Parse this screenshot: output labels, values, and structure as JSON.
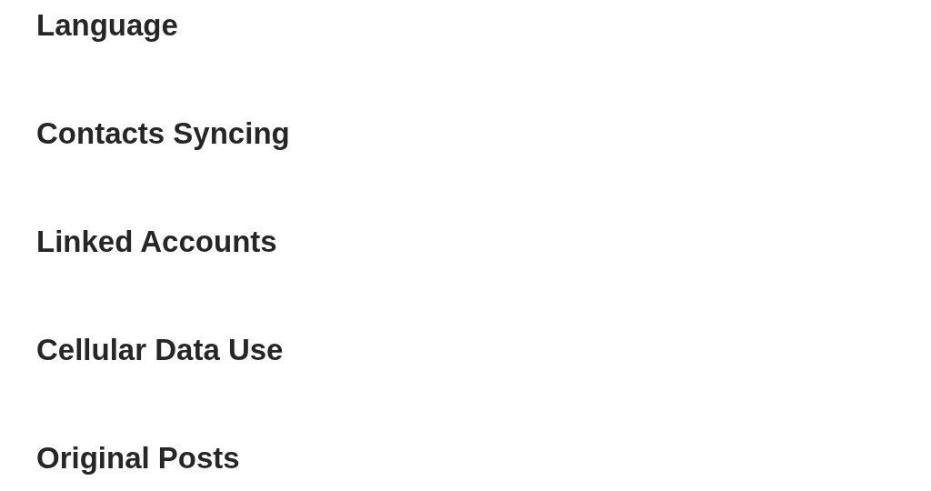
{
  "settings_items": [
    {
      "label": "Language"
    },
    {
      "label": "Contacts Syncing"
    },
    {
      "label": "Linked Accounts"
    },
    {
      "label": "Cellular Data Use"
    },
    {
      "label": "Original Posts"
    }
  ]
}
